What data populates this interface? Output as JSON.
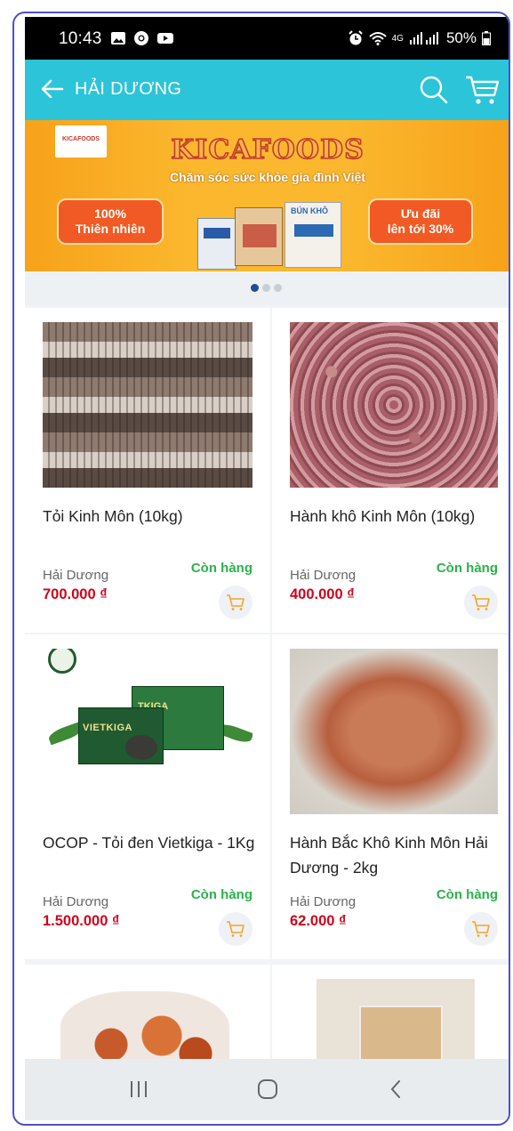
{
  "status_bar": {
    "time": "10:43",
    "network": "4G",
    "battery": "50%"
  },
  "header": {
    "title": "HẢI DƯƠNG",
    "back_icon": "arrow-left-icon",
    "search_icon": "search-icon",
    "cart_icon": "cart-icon"
  },
  "banner": {
    "brand": "KICAFOODS",
    "logo_text": "KICAFOODS",
    "tagline": "Chăm sóc sức khỏe gia đình Việt",
    "badge_left_line1": "100%",
    "badge_left_line2": "Thiên nhiên",
    "badge_right_line1": "Ưu đãi",
    "badge_right_line2": "lên tới 30%",
    "product_label": "BÚN KHÔ",
    "carousel_pages": 3,
    "carousel_active_index": 0
  },
  "products": [
    {
      "name": "Tỏi Kinh Môn (10kg)",
      "location": "Hải Dương",
      "stock": "Còn hàng",
      "price": "700.000 ₫"
    },
    {
      "name": "Hành khô Kinh Môn (10kg)",
      "location": "Hải Dương",
      "stock": "Còn hàng",
      "price": "400.000 ₫"
    },
    {
      "name": "OCOP - Tỏi đen Vietkiga - 1Kg",
      "location": "Hải Dương",
      "stock": "Còn hàng",
      "price": "1.500.000 ₫",
      "box_label": "VIETKIGA",
      "box_label_2": "TKIGA"
    },
    {
      "name": "Hành Bắc Khô Kinh Môn Hải Dương - 2kg",
      "location": "Hải Dương",
      "stock": "Còn hàng",
      "price": "62.000 ₫"
    }
  ],
  "colors": {
    "header": "#2bc4d8",
    "price": "#d0021b",
    "in_stock": "#2bb24c",
    "banner": "#fbb82e"
  },
  "nav": {
    "recent_icon": "recent-apps-icon",
    "home_icon": "home-icon",
    "back_icon": "back-chevron-icon"
  }
}
